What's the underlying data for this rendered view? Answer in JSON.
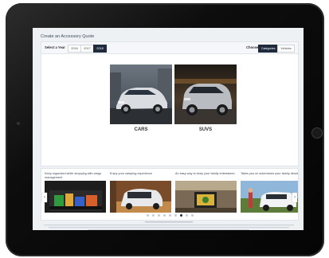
{
  "page": {
    "title": "Create an Accessory Quote"
  },
  "year_selector": {
    "label": "Select a Year",
    "years": [
      "2016",
      "2017",
      "2018"
    ],
    "selected": "2018"
  },
  "choose_selector": {
    "label": "Choose",
    "options": [
      "Categories",
      "Vehicles"
    ],
    "selected": "Categories"
  },
  "categories": [
    {
      "label": "CARS"
    },
    {
      "label": "SUVS"
    }
  ],
  "promos": [
    {
      "text": "Keep organized while shopping with cargo management"
    },
    {
      "text": "Enjoy your camping experience"
    },
    {
      "text": "An easy way to keep your family entertained"
    },
    {
      "text": "Takes you on adventures your family desires!"
    }
  ],
  "carousel": {
    "dot_count": 9,
    "active_index": 6,
    "prev_icon": "chevron-left-icon",
    "next_icon": "chevron-right-icon"
  },
  "colors": {
    "accent": "#1f2b3d",
    "background": "#eef1f4"
  }
}
